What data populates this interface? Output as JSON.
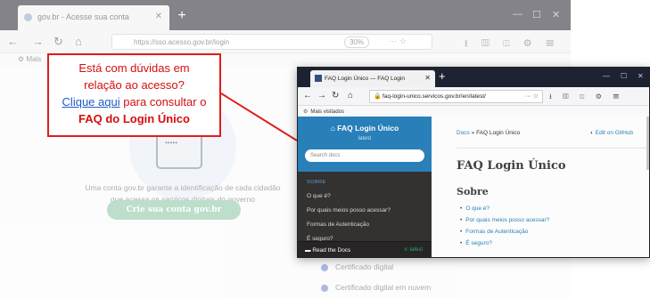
{
  "background_browser": {
    "tab_title": "gov.br - Acesse sua conta",
    "url": "https://sso.acesso.gov.br/login",
    "zoom": "30%",
    "bookmarks_label": "Mais",
    "body_text": "Uma conta gov.br garante a identificação de cada cidadão que acessa os serviços digitais do governo",
    "create_account_label": "Crie sua conta gov.br",
    "list_items": [
      "Certificado digital",
      "Certificado digital em nuvem"
    ]
  },
  "callout": {
    "line1": "Está com dúvidas em",
    "line2": "relação ao acesso?",
    "link_text": "Clique aqui",
    "line3_rest": "para consultar o",
    "line4": "FAQ do Login Único"
  },
  "foreground_browser": {
    "tab_title": "FAQ Login Único — FAQ Login",
    "url": "faq-login-unico.servicos.gov.br/en/latest/",
    "bookmarks_label": "Mais visitados",
    "sidebar": {
      "title": "FAQ Login Único",
      "version": "latest",
      "search_placeholder": "Search docs",
      "caption": "SOBRE",
      "items": [
        "O que é?",
        "Por quais meios posso acessar?",
        "Formas de Autenticação",
        "É seguro?"
      ],
      "footer_label": "Read the Docs",
      "footer_version": "v: latest"
    },
    "content": {
      "breadcrumb_docs": "Docs",
      "breadcrumb_sep": "»",
      "breadcrumb_current": "FAQ Login Único",
      "edit_link": "Edit on GitHub",
      "heading": "FAQ Login Único",
      "subheading": "Sobre",
      "toc": [
        "O que é?",
        "Por quais meios posso acessar?",
        "Formas de Autenticação",
        "É seguro?"
      ]
    }
  },
  "colors": {
    "callout_border": "#e21d1d",
    "callout_text": "#d40e0e",
    "link": "#1e5cc4",
    "sidebar_header": "#2980b9",
    "sidebar_bg": "#343131"
  }
}
